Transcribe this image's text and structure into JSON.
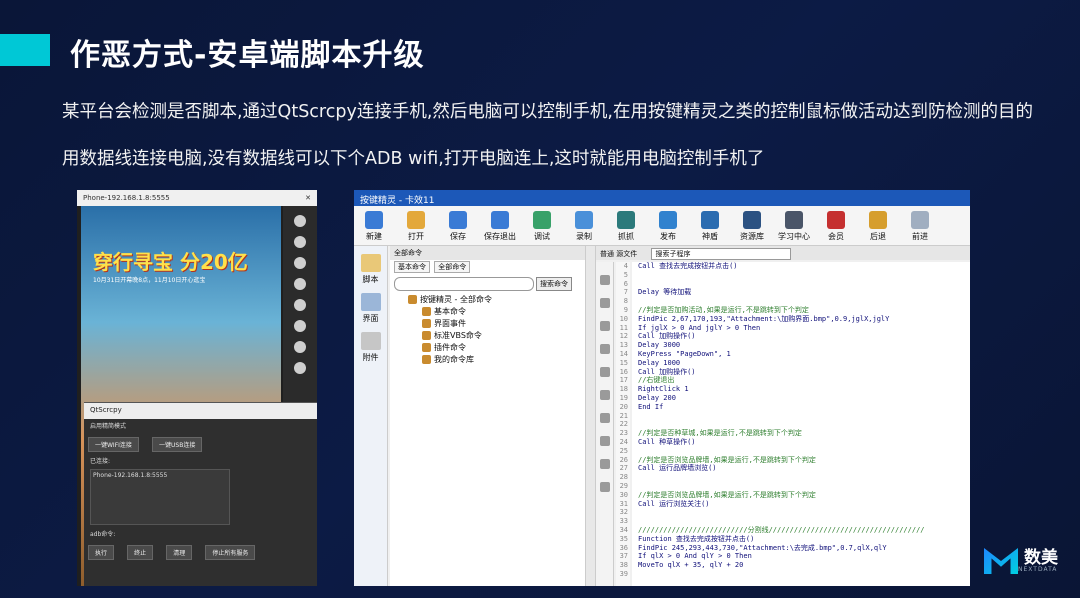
{
  "slide": {
    "title": "作恶方式-安卓端脚本升级",
    "paragraph1": "某平台会检测是否脚本,通过QtScrcpy连接手机,然后电脑可以控制手机,在用按键精灵之类的控制鼠标做活动达到防检测的目的",
    "paragraph2": "用数据线连接电脑,没有数据线可以下个ADB wifi,打开电脑连上,这时就能用电脑控制手机了"
  },
  "phone_window": {
    "title": "Phone-192.168.1.8:5555",
    "banner_title": "穿行寻宝 分20亿",
    "banner_sub": "10月31日开幕晚8点，11月10日开心逛宝",
    "panel_title": "QtScrcpy",
    "panel_mode": "启用精简模式",
    "btn_wifi": "一键WIFI连接",
    "btn_usb": "一键USB连接",
    "connected_label": "已连接:",
    "device_item": "Phone-192.168.1.8:5555",
    "adb_label": "adb命令:",
    "btn_exec": "执行",
    "btn_stop": "终止",
    "btn_clear": "清理",
    "btn_stop_service": "停止所有服务"
  },
  "keysprite": {
    "window_title": "按键精灵 - 卡效11",
    "toolbar": [
      {
        "label": "新建",
        "color": "#3a7bd5"
      },
      {
        "label": "打开",
        "color": "#e3a83b"
      },
      {
        "label": "保存",
        "color": "#3a7bd5"
      },
      {
        "label": "保存退出",
        "color": "#3a7bd5"
      },
      {
        "label": "调试",
        "color": "#38a169"
      },
      {
        "label": "录制",
        "color": "#4a90d9"
      },
      {
        "label": "抓抓",
        "color": "#2c7a7b"
      },
      {
        "label": "发布",
        "color": "#3182ce"
      },
      {
        "label": "神盾",
        "color": "#2b6cb0"
      },
      {
        "label": "资源库",
        "color": "#2c5282"
      },
      {
        "label": "学习中心",
        "color": "#4a5568"
      },
      {
        "label": "会员",
        "color": "#c53030"
      },
      {
        "label": "后退",
        "color": "#d69e2e"
      },
      {
        "label": "前进",
        "color": "#a0aec0"
      }
    ],
    "left_nav": [
      "脚本",
      "界面",
      "附件"
    ],
    "tree_header": "全部命令",
    "tree_tabs": [
      "基本命令",
      "全部命令"
    ],
    "search_btn": "搜索命令",
    "tree_root": "按键精灵 - 全部命令",
    "tree_children": [
      "基本命令",
      "界面事件",
      "标准VBS命令",
      "插件命令",
      "我的命令库"
    ],
    "code_tabs": [
      "普通",
      "源文件"
    ],
    "code_select": "搜索子程序",
    "line_numbers": [
      "4",
      "5",
      "6",
      "7",
      "8",
      "9",
      "10",
      "11",
      "12",
      "13",
      "14",
      "15",
      "16",
      "17",
      "18",
      "19",
      "20",
      "21",
      "22",
      "23",
      "24",
      "25",
      "26",
      "27",
      "28",
      "29",
      "30",
      "31",
      "32",
      "33",
      "34",
      "35",
      "36",
      "37",
      "38",
      "39"
    ],
    "code": [
      "Call 查找去完成按钮并点击()",
      "",
      "",
      "Delay 等待加载",
      "",
      "//判定是否加购活动,如果是运行,不是跳转到下个判定",
      "FindPic 2,67,170,193,\"Attachment:\\加购界面.bmp\",0.9,jglX,jglY",
      "If jglX > 0 And jglY > 0 Then",
      "Call 加购操作()",
      "Delay 3000",
      "KeyPress \"PageDown\", 1",
      "Delay 1000",
      "Call 加购操作()",
      "//右键退出",
      "RightClick 1",
      "Delay 200",
      "End If",
      "",
      "",
      "//判定是否种草城,如果是运行,不是跳转到下个判定",
      "Call 种草操作()",
      "",
      "//判定是否浏览品牌墙,如果是运行,不是跳转到下个判定",
      "Call 运行品牌墙浏览()",
      "",
      "",
      "//判定是否浏览品牌墙,如果是运行,不是跳转到下个判定",
      "Call 运行浏览关注()",
      "",
      "",
      "//////////////////////////分割线/////////////////////////////////////",
      "Function 查找去完成按钮并点击()",
      "FindPic 245,293,443,730,\"Attachment:\\去完成.bmp\",0.7,qlX,qlY",
      "If qlX > 0 And qlY > 0 Then",
      "MoveTo qlX + 35, qlY + 20",
      ""
    ]
  },
  "brand": {
    "name": "数美",
    "sub": "NEXTDATA"
  }
}
